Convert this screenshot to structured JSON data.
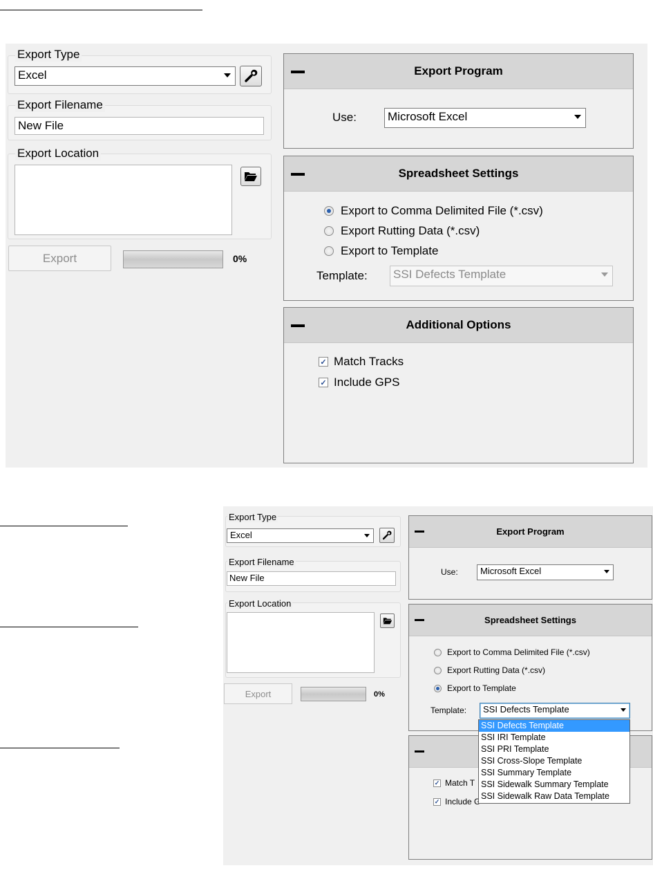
{
  "screen1": {
    "export_type": {
      "label": "Export Type",
      "value": "Excel",
      "settings_icon": "wrench-icon"
    },
    "export_filename": {
      "label": "Export Filename",
      "value": "New File"
    },
    "export_location": {
      "label": "Export Location",
      "value": "",
      "browse_icon": "folder-open-icon"
    },
    "export_button": "Export",
    "progress": {
      "percent_label": "0%",
      "value": 0
    },
    "export_program": {
      "title": "Export Program",
      "use_label": "Use:",
      "use_value": "Microsoft Excel"
    },
    "spreadsheet_settings": {
      "title": "Spreadsheet Settings",
      "options": [
        "Export to Comma Delimited File (*.csv)",
        "Export Rutting Data (*.csv)",
        "Export to Template"
      ],
      "selected_index": 0,
      "template_label": "Template:",
      "template_value": "SSI Defects Template"
    },
    "additional_options": {
      "title": "Additional Options",
      "match_tracks": "Match Tracks",
      "include_gps": "Include GPS"
    }
  },
  "screen2": {
    "export_type": {
      "label": "Export Type",
      "value": "Excel"
    },
    "export_filename": {
      "label": "Export Filename",
      "value": "New File"
    },
    "export_location": {
      "label": "Export Location"
    },
    "export_button": "Export",
    "progress": {
      "percent_label": "0%",
      "value": 0
    },
    "export_program": {
      "title": "Export Program",
      "use_label": "Use:",
      "use_value": "Microsoft Excel"
    },
    "spreadsheet_settings": {
      "title": "Spreadsheet Settings",
      "options": [
        "Export to Comma Delimited File (*.csv)",
        "Export Rutting Data (*.csv)",
        "Export to Template"
      ],
      "selected_index": 2,
      "template_label": "Template:",
      "template_value": "SSI Defects Template"
    },
    "template_dropdown": [
      "SSI Defects Template",
      "SSI IRI Template",
      "SSI PRI Template",
      "SSI Cross-Slope Template",
      "SSI Summary Template",
      "SSI Sidewalk Summary Template",
      "SSI Sidewalk Raw Data Template"
    ],
    "additional_options": {
      "match_tracks_partial": "Match T",
      "include_gps_partial": "Include G"
    }
  },
  "colors": {
    "panel_header": "#d6d6d6",
    "selection": "#3399ff",
    "radio_dot": "#2a5fad"
  }
}
